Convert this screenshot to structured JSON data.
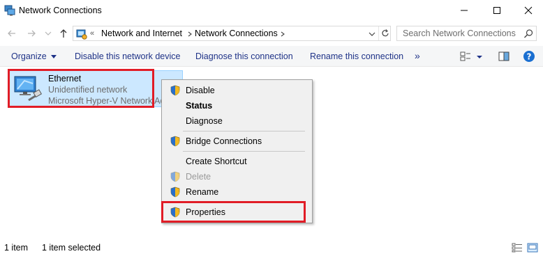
{
  "window": {
    "title": "Network Connections"
  },
  "address_bar": {
    "overflow_chevron": "«",
    "crumbs": [
      "Network and Internet",
      "Network Connections"
    ]
  },
  "search": {
    "placeholder": "Search Network Connections"
  },
  "command_bar": {
    "organize": "Organize",
    "disable": "Disable this network device",
    "diagnose": "Diagnose this connection",
    "rename": "Rename this connection",
    "more": "»"
  },
  "item": {
    "name": "Ethernet",
    "status": "Unidentified network",
    "adapter": "Microsoft Hyper-V Network Ad"
  },
  "context_menu": {
    "items": [
      {
        "label": "Disable",
        "shield": true,
        "bold": false,
        "disabled": false
      },
      {
        "label": "Status",
        "shield": false,
        "bold": true,
        "disabled": false
      },
      {
        "label": "Diagnose",
        "shield": false,
        "bold": false,
        "disabled": false
      },
      {
        "label": "Bridge Connections",
        "shield": true,
        "bold": false,
        "disabled": false
      },
      {
        "label": "Create Shortcut",
        "shield": false,
        "bold": false,
        "disabled": false
      },
      {
        "label": "Delete",
        "shield": true,
        "bold": false,
        "disabled": true
      },
      {
        "label": "Rename",
        "shield": true,
        "bold": false,
        "disabled": false
      },
      {
        "label": "Properties",
        "shield": true,
        "bold": false,
        "disabled": false
      }
    ]
  },
  "status_bar": {
    "count": "1 item",
    "selected": "1 item selected"
  },
  "colors": {
    "accent": "#1e3287",
    "selection": "#cce8ff",
    "highlight_box": "#e11c26"
  }
}
